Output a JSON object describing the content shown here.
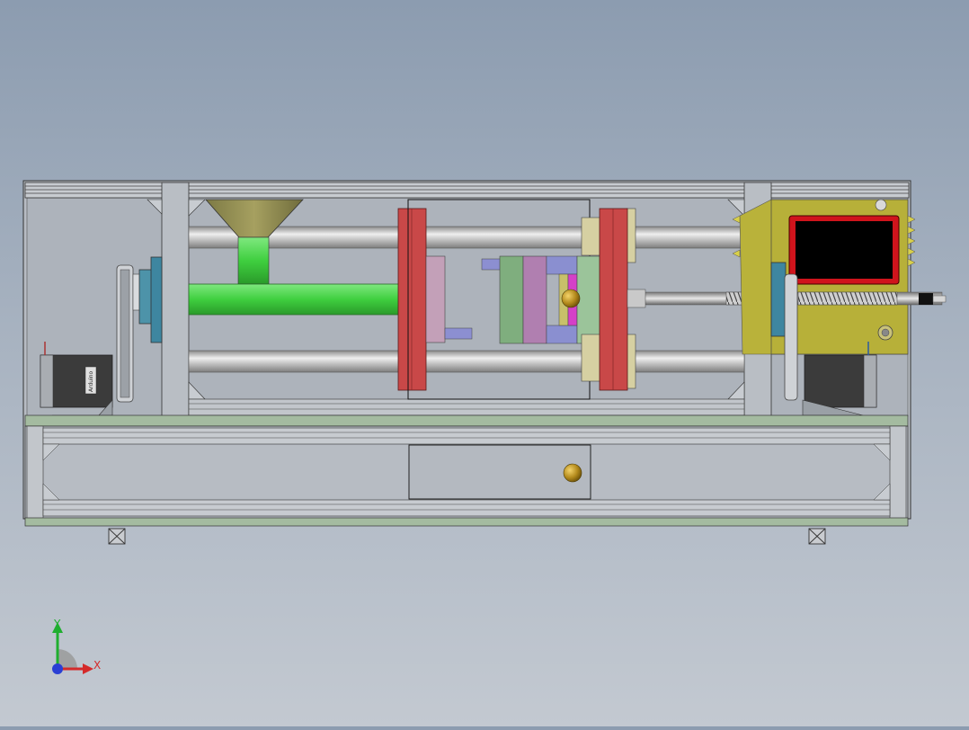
{
  "viewport": {
    "background_top": "#8c9cb0",
    "background_bottom": "#c3c9d1"
  },
  "model": {
    "hopper_color": "#9a9350",
    "barrel_color": "#3fcf3f",
    "platen_color": "#c94848",
    "panel_color": "#b9b23a",
    "screen_color": "#000000",
    "screen_bezel_color": "#d0141c",
    "frame_color": "#b4b8be",
    "base_color": "#a4bba0",
    "motor_label_left": "Arduino"
  },
  "triad": {
    "x_label": "X",
    "y_label": "Y",
    "x_color": "#d42a2a",
    "y_color": "#1fae2f",
    "z_color": "#2a3fd4"
  }
}
